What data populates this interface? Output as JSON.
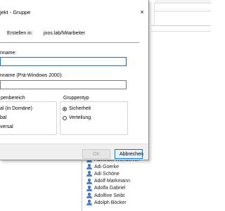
{
  "dialog": {
    "title": "jekt - Gruppe",
    "created_in_label": "Erstellen in:",
    "created_in_value": "joos.lab/Mitarbeiter",
    "group_name_label": "nname:",
    "group_name_value": "",
    "group_name_pre2000_label": "nname (Prä-Windows 2000):",
    "group_name_pre2000_value": "",
    "scope": {
      "title": "penbereich",
      "options": [
        "al (in Domäne)",
        "bal",
        "versal"
      ]
    },
    "type": {
      "title": "Gruppentyp",
      "options": [
        "Sicherheit",
        "Verteilung"
      ],
      "selected": "Sicherheit"
    },
    "buttons": {
      "ok": "OK",
      "cancel": "Abbrechen"
    },
    "close_icon": "×"
  },
  "user_list": {
    "items": [
      "Adeltraut Wunderlich",
      "Adi Goerke",
      "Adi Schöne",
      "Adolf Markmann",
      "Adolfa Gabriel",
      "Adolfine Seibt",
      "Adolph Böcker"
    ]
  },
  "colors": {
    "accent": "#0078d7",
    "user_icon": "#4f82c8"
  }
}
